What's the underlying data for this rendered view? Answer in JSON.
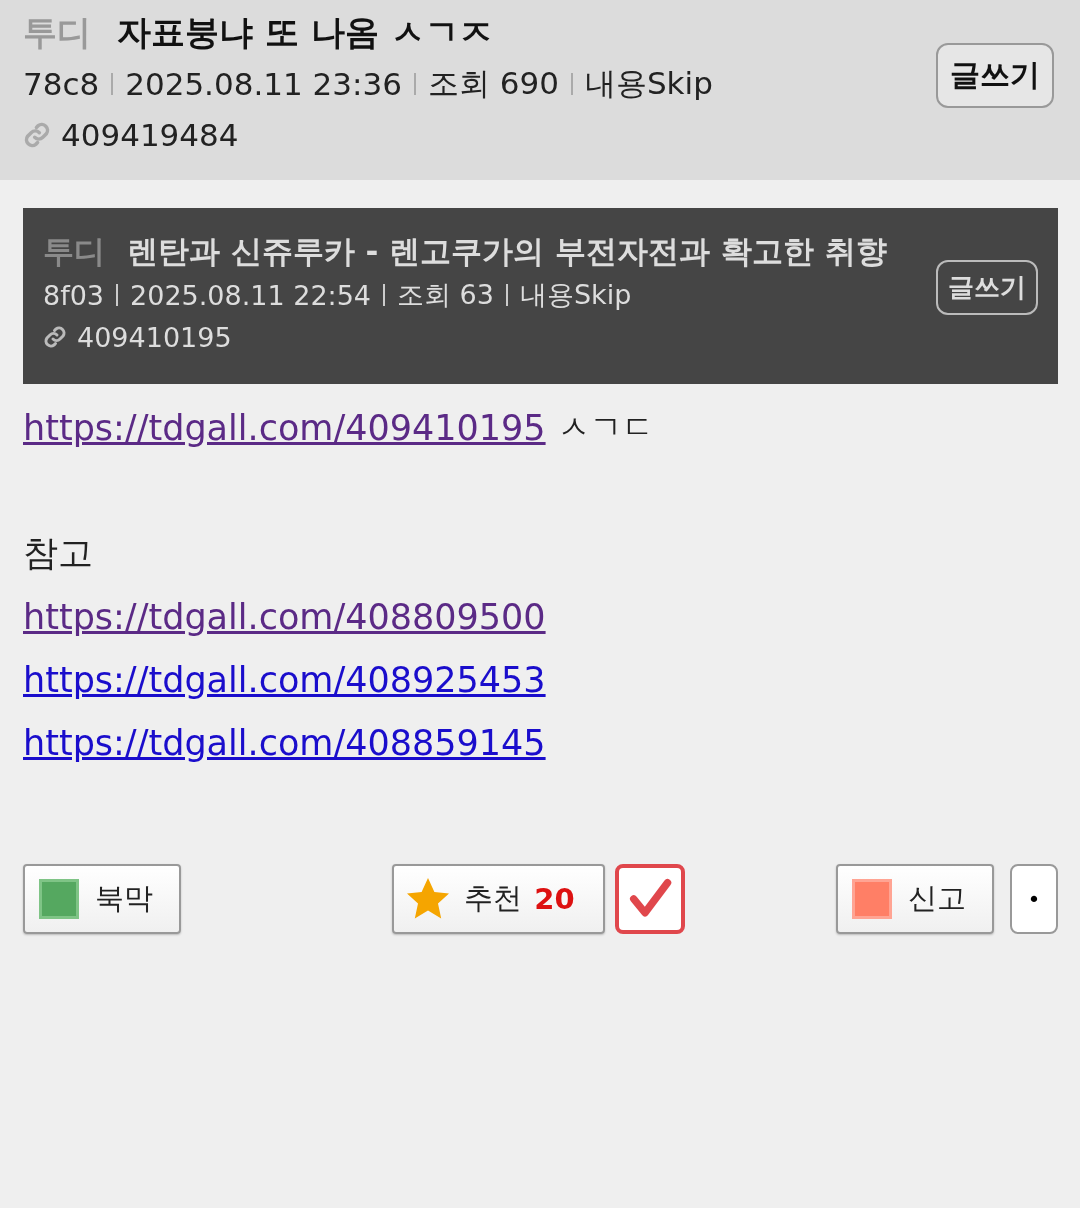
{
  "header": {
    "gallery": "투디",
    "title": "자표붕냐 또 나옴 ㅅㄱㅈ",
    "meta": [
      "78c8",
      "2025.08.11 23:36",
      "조회 690",
      "내용Skip"
    ],
    "post_id": "409419484",
    "write_button": "글쓰기"
  },
  "quoted": {
    "gallery": "투디",
    "title": "렌탄과 신쥬루카 - 렌고쿠가의 부전자전과 확고한 취향",
    "meta": [
      "8f03",
      "2025.08.11 22:54",
      "조회 63",
      "내용Skip"
    ],
    "post_id": "409410195",
    "write_button": "글쓰기"
  },
  "body": [
    {
      "kind": "link",
      "url": "https://tdgall.com/409410195",
      "visited": true,
      "after": "ㅅㄱㄷ"
    },
    {
      "kind": "blank"
    },
    {
      "kind": "text",
      "text": "참고"
    },
    {
      "kind": "link",
      "url": "https://tdgall.com/408809500",
      "visited": true
    },
    {
      "kind": "link",
      "url": "https://tdgall.com/408925453",
      "visited": false
    },
    {
      "kind": "link",
      "url": "https://tdgall.com/408859145",
      "visited": false
    }
  ],
  "actions": {
    "bookmark": "북막",
    "recommend": "추천",
    "recommend_count": "20",
    "checked": true,
    "report": "신고",
    "more": "•"
  }
}
